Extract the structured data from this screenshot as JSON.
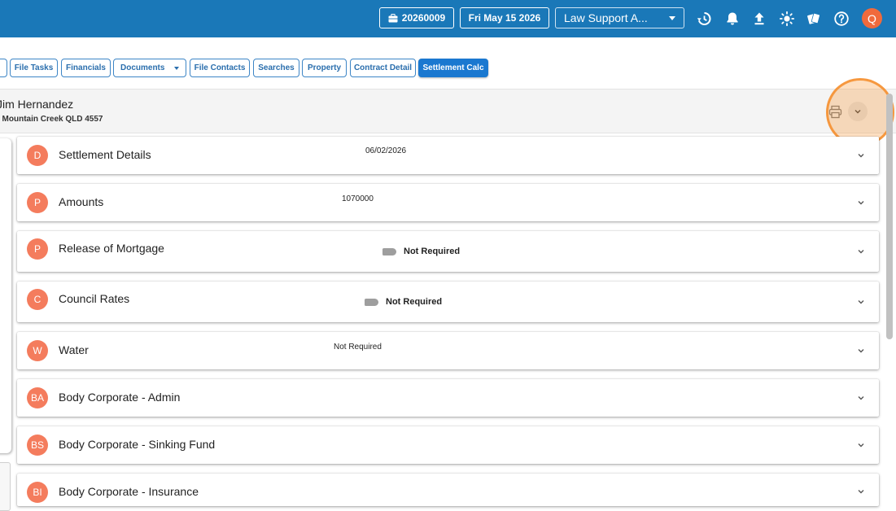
{
  "topbar": {
    "file_number": "20260009",
    "date": "Fri May 15 2026",
    "workspace_select": "Law Support A...",
    "avatar_initial": "Q",
    "bar_color": "#1a78b8"
  },
  "tabs": [
    {
      "label": "File Tasks"
    },
    {
      "label": "Financials"
    },
    {
      "label": "Documents"
    },
    {
      "label": "File Contacts"
    },
    {
      "label": "Searches"
    },
    {
      "label": "Property"
    },
    {
      "label": "Contract Detail"
    },
    {
      "label": "Settlement Calc",
      "active": true
    }
  ],
  "header": {
    "client_name": "Jim Hernandez",
    "address": ", Mountain Creek QLD 4557"
  },
  "sections": [
    {
      "badge": "D",
      "title": "Settlement Details",
      "value": "06/02/2026"
    },
    {
      "badge": "P",
      "title": "Amounts",
      "value": "1070000"
    },
    {
      "badge": "P",
      "title": "Release of Mortgage",
      "status": "Not Required"
    },
    {
      "badge": "C",
      "title": "Council Rates",
      "status": "Not Required"
    },
    {
      "badge": "W",
      "title": "Water",
      "value": "Not Required"
    },
    {
      "badge": "BA",
      "title": "Body Corporate - Admin"
    },
    {
      "badge": "BS",
      "title": "Body Corporate - Sinking Fund"
    },
    {
      "badge": "BI",
      "title": "Body Corporate - Insurance"
    }
  ],
  "icons": {
    "file": "briefcase-icon",
    "history": "history-icon",
    "notifications": "bell-icon",
    "upload": "upload-icon",
    "theme": "sun-icon",
    "cards": "cards-icon",
    "help": "help-icon",
    "print": "printer-icon",
    "expand": "chevron-down-icon"
  },
  "colors": {
    "accent": "#1a78d0",
    "badge": "#f47c5d",
    "highlight": "#f59632"
  }
}
